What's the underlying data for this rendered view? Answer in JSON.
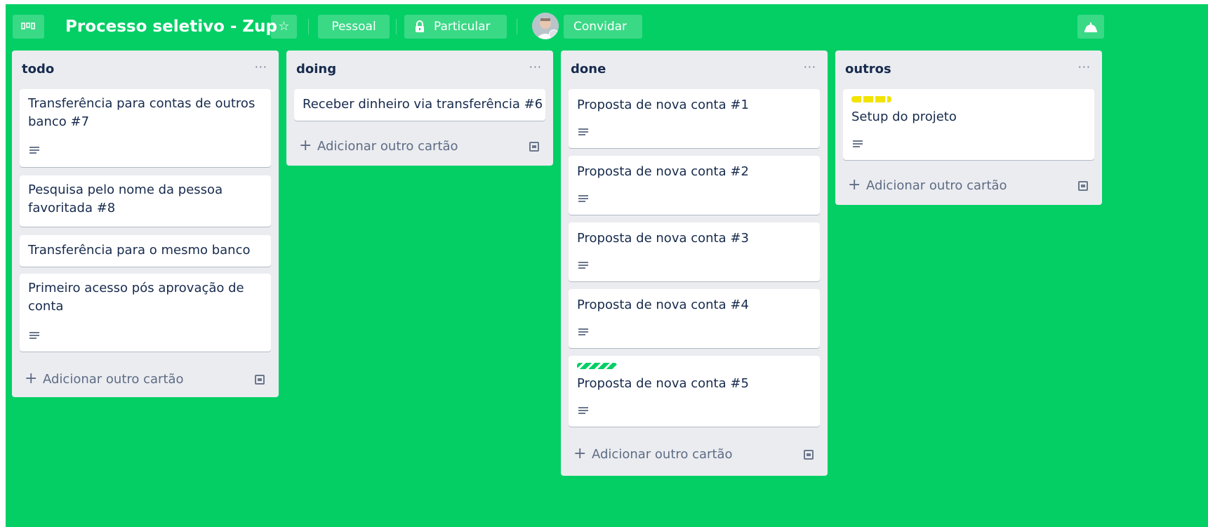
{
  "board": {
    "title": "Processo seletivo - Zup",
    "visibility_label": "Pessoal",
    "privacy_label": "Particular",
    "invite_label": "Convidar",
    "background": "#03cf65"
  },
  "lists": [
    {
      "title": "todo",
      "menu": "···",
      "cards": [
        {
          "title": "Transferência para contas de outros banco #7",
          "has_description": true
        },
        {
          "title": "Pesquisa pelo nome da pessoa favoritada #8",
          "has_description": false
        },
        {
          "title": "Transferência para o mesmo banco",
          "has_description": false
        },
        {
          "title": "Primeiro acesso pós aprovação de conta",
          "has_description": true
        }
      ],
      "add_label": "Adicionar outro cartão"
    },
    {
      "title": "doing",
      "menu": "···",
      "cards": [
        {
          "title": "Receber dinheiro via transferência #6",
          "has_description": false
        }
      ],
      "add_label": "Adicionar outro cartão"
    },
    {
      "title": "done",
      "menu": "···",
      "cards": [
        {
          "title": "Proposta de nova conta #1",
          "has_description": true
        },
        {
          "title": "Proposta de nova conta #2",
          "has_description": true
        },
        {
          "title": "Proposta de nova conta #3",
          "has_description": true
        },
        {
          "title": "Proposta de nova conta #4",
          "has_description": true
        },
        {
          "title": "Proposta de nova conta #5",
          "has_description": true,
          "label_color": "#03cf65"
        }
      ],
      "add_label": "Adicionar outro cartão"
    },
    {
      "title": "outros",
      "menu": "···",
      "cards": [
        {
          "title": "Setup do projeto",
          "has_description": true,
          "label_color": "#f2e300"
        }
      ],
      "add_label": "Adicionar outro cartão"
    }
  ]
}
